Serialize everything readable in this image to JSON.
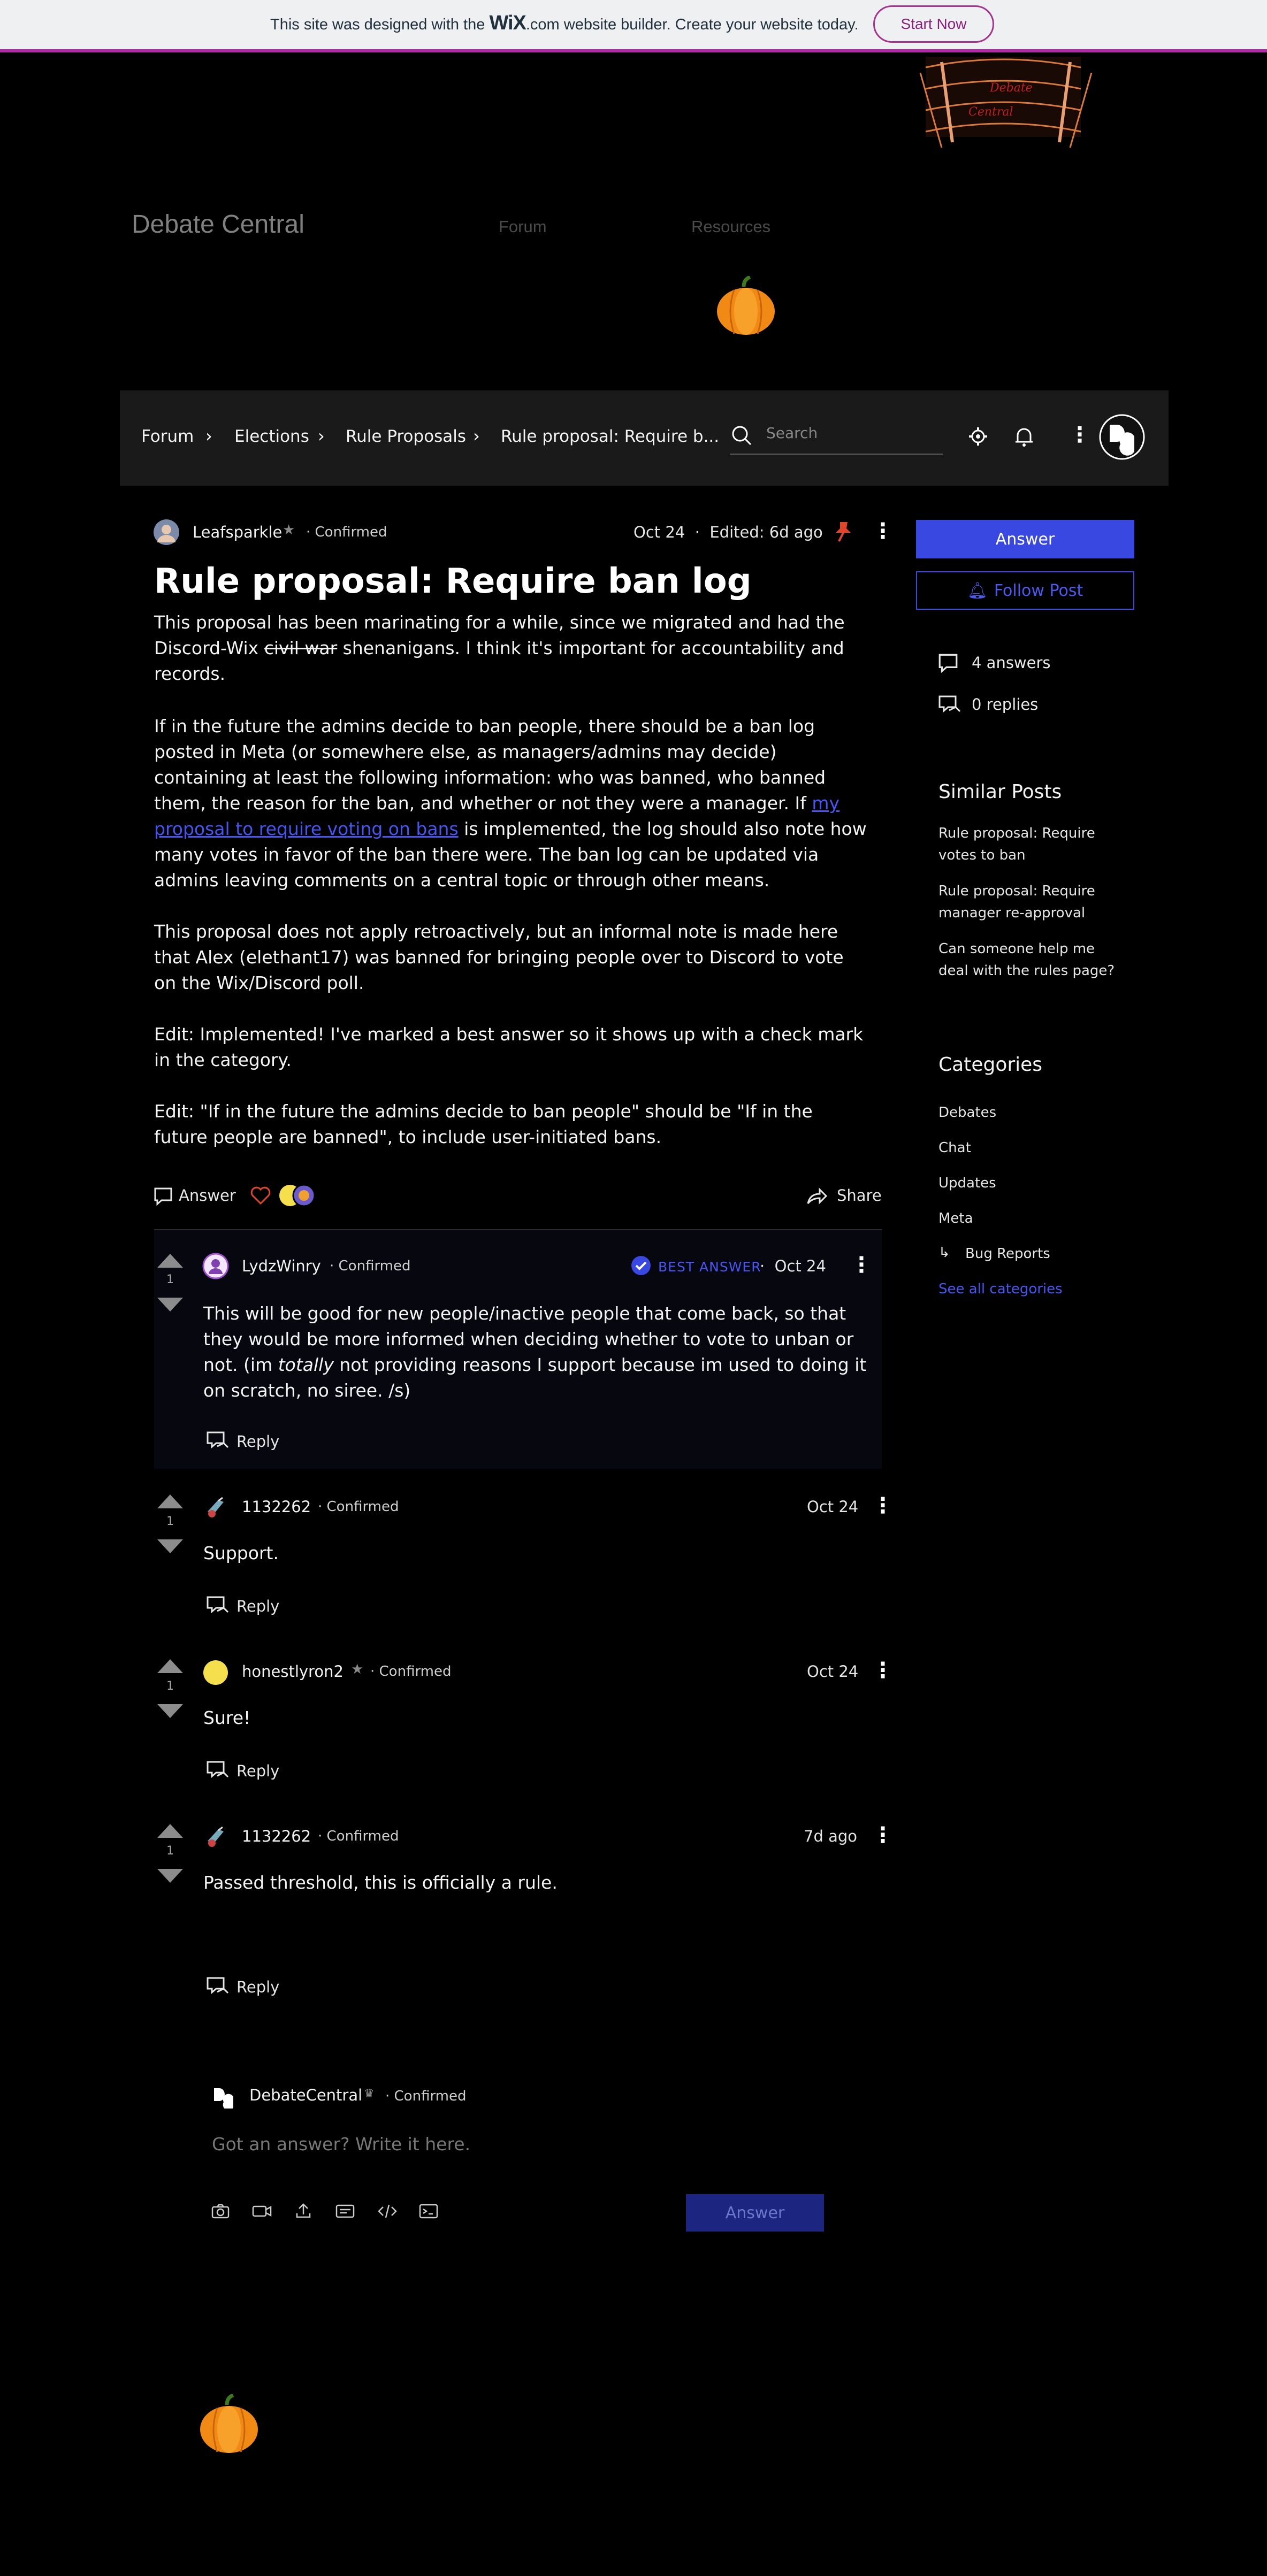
{
  "wix_banner": {
    "text_before": "This site was designed with the ",
    "wix_logo": "WiX",
    "text_after": ".com website builder. Create your website today.",
    "start_now": "Start Now"
  },
  "site": {
    "title": "Debate Central",
    "nav": [
      "Forum",
      "Resources"
    ]
  },
  "breadcrumb": [
    "Forum",
    "Elections",
    "Rule Proposals",
    "Rule proposal: Require b..."
  ],
  "search": {
    "placeholder": "Search"
  },
  "post": {
    "author": "Leafsparkle",
    "author_status": "Confirmed",
    "date": "Oct 24",
    "edited": "Edited: 6d ago",
    "title": "Rule proposal: Require ban log",
    "p1_a": "This proposal has been marinating for a while, since we migrated and had the Discord-Wix ",
    "p1_strike": " civil war",
    "p1_b": " shenanigans. I think it's important for accountability and records.",
    "p2_a": "If in the future the admins decide to ban people, there should be a ban log posted in Meta (or somewhere else, as managers/admins may decide) containing at least the following information: who was banned, who banned them, the reason for the ban, and whether or not they were a manager. If ",
    "p2_link": "my proposal to require voting on bans",
    "p2_b": " is implemented, the log should also note how many votes in favor of the ban there were. The ban log can be updated via admins leaving comments on a central topic or through other means.",
    "p3": "This proposal does not apply retroactively, but an informal note is made here that Alex (elethant17) was banned for bringing people over to Discord to vote on the Wix/Discord poll.",
    "p4": "Edit: Implemented! I've marked a best answer so it shows up with a check mark in the category.",
    "p5": "Edit: \"If in the future the admins decide to ban people\" should be \"If in the future people are banned\", to include user-initiated bans.",
    "answer_label": "Answer",
    "share_label": "Share"
  },
  "sidebar": {
    "answer_button": "Answer",
    "follow_button": "Follow Post",
    "answers_count": "4 answers",
    "replies_count": "0 replies",
    "similar_heading": "Similar Posts",
    "similar_posts": [
      "Rule proposal: Require votes to ban",
      "Rule proposal: Require manager re-approval",
      "Can someone help me deal with the rules page?"
    ],
    "categories_heading": "Categories",
    "categories": [
      "Debates",
      "Chat",
      "Updates",
      "Meta",
      "Bug Reports"
    ],
    "see_all": "See all categories"
  },
  "answers": [
    {
      "votes": "1",
      "author": "LydzWinry",
      "status": "Confirmed",
      "best_answer": "BEST ANSWER",
      "date": "Oct 24",
      "text_a": "This will be good for new people/inactive people that come back, so that they would be more informed when deciding whether to vote to unban or not. (im ",
      "text_em": "totally",
      "text_b": " not providing reasons I support because im used to doing it on scratch, no siree. /s)",
      "reply": "Reply"
    },
    {
      "votes": "1",
      "author": "1132262",
      "status": "Confirmed",
      "date": "Oct 24",
      "text": "Support.",
      "reply": "Reply"
    },
    {
      "votes": "1",
      "author": "honestlyron2",
      "status": "Confirmed",
      "date": "Oct 24",
      "text": "Sure!",
      "reply": "Reply"
    },
    {
      "votes": "1",
      "author": "1132262",
      "status": "Confirmed",
      "date": "7d ago",
      "text": "Passed threshold, this is officially a rule.",
      "reply": "Reply"
    }
  ],
  "composer": {
    "author": "DebateCentral",
    "status": "Confirmed",
    "placeholder": "Got an answer? Write it here.",
    "submit": "Answer"
  },
  "colors": {
    "accent": "#3848e0",
    "banner_border": "#b12aa6",
    "link": "#4655f5"
  }
}
